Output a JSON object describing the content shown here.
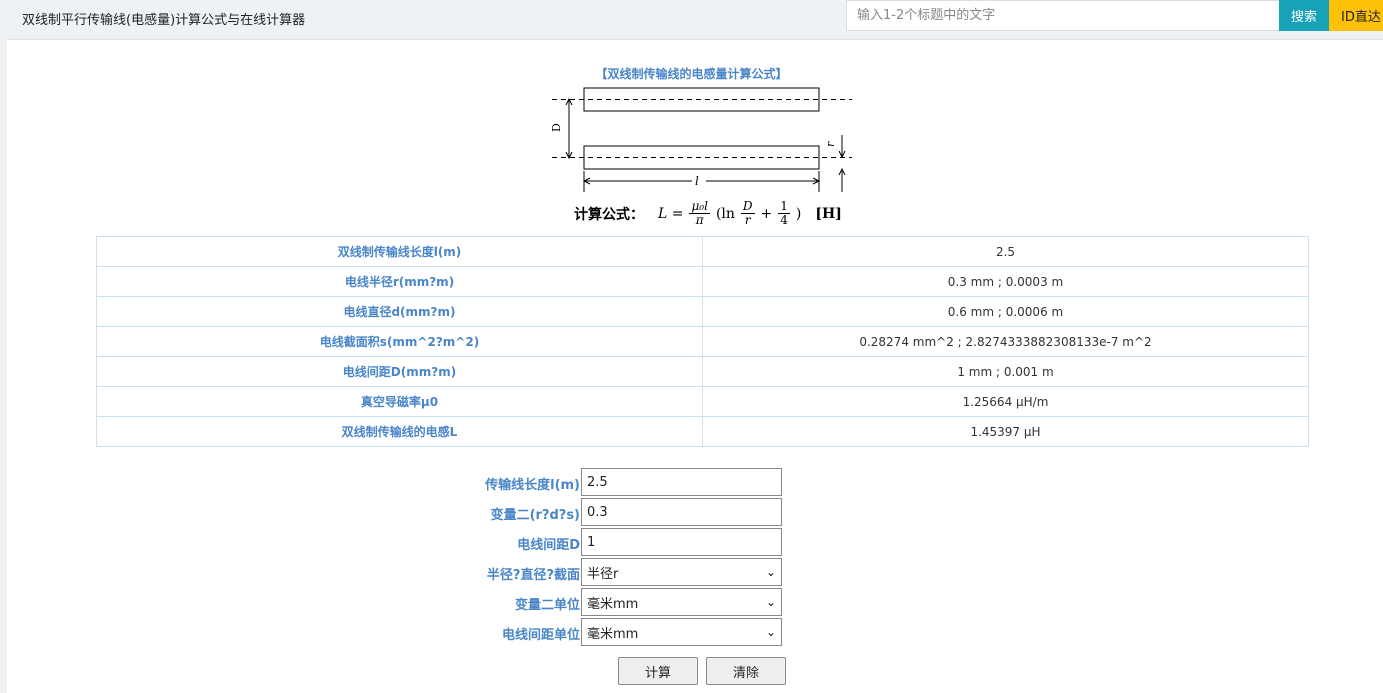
{
  "header": {
    "title": "双线制平行传输线(电感量)计算公式与在线计算器",
    "search_placeholder": "输入1-2个标题中的文字",
    "search_label": "搜索",
    "id_label": "ID直达"
  },
  "diagram": {
    "title": "【双线制传输线的电感量计算公式】",
    "label_D": "D",
    "label_r": "r",
    "label_l": "l",
    "formula_label": "计算公式：",
    "formula_lhs": "L =",
    "formula_num": "μ₀l",
    "formula_den": "π",
    "formula_ln": "(ln",
    "formula_inner_num": "D",
    "formula_inner_den": "r",
    "formula_plus": "+",
    "formula_q_num": "1",
    "formula_q_den": "4",
    "formula_close": ")",
    "formula_unit": "[H]"
  },
  "results": [
    {
      "label": "双线制传输线长度l(m)",
      "value": "2.5"
    },
    {
      "label": "电线半径r(mm?m)",
      "value": "0.3 mm ; 0.0003 m"
    },
    {
      "label": "电线直径d(mm?m)",
      "value": "0.6 mm ; 0.0006 m"
    },
    {
      "label": "电线截面积s(mm^2?m^2)",
      "value": "0.28274 mm^2 ; 2.8274333882308133e-7 m^2"
    },
    {
      "label": "电线间距D(mm?m)",
      "value": "1 mm ; 0.001 m"
    },
    {
      "label": "真空导磁率μ0",
      "value": "1.25664 μH/m"
    },
    {
      "label": "双线制传输线的电感L",
      "value": "1.45397 μH"
    }
  ],
  "form": {
    "length_label": "传输线长度l(m)",
    "length_value": "2.5",
    "var2_label": "变量二(r?d?s)",
    "var2_value": "0.3",
    "spacing_label": "电线间距D",
    "spacing_value": "1",
    "type_label": "半径?直径?截面",
    "type_value": "半径r",
    "var2_unit_label": "变量二单位",
    "var2_unit_value": "毫米mm",
    "spacing_unit_label": "电线间距单位",
    "spacing_unit_value": "毫米mm",
    "calc_label": "计算",
    "clear_label": "清除"
  },
  "colors": {
    "accent": "#4a86c8",
    "search_button": "#17a2b8",
    "id_button": "#ffc107"
  }
}
